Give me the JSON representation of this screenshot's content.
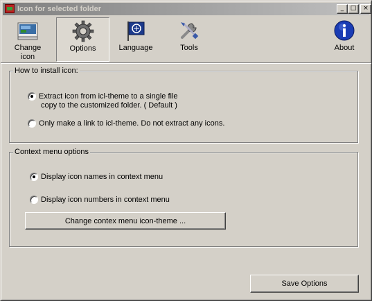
{
  "window": {
    "title": "Icon for selected folder",
    "minimize_glyph": "_",
    "maximize_glyph": "□",
    "close_glyph": "×"
  },
  "toolbar": {
    "items": [
      {
        "label": "Change\nicon",
        "icon": "change-icon-icon"
      },
      {
        "label": "Options",
        "icon": "gear-icon",
        "selected": true
      },
      {
        "label": "Language",
        "icon": "language-flag-icon"
      },
      {
        "label": "Tools",
        "icon": "tools-icon"
      },
      {
        "label": "About",
        "icon": "info-icon"
      }
    ]
  },
  "install_group": {
    "title": "How to install icon:",
    "option1_line1": "Extract icon from icl-theme to a single file",
    "option1_line2": "copy to the customized folder. ( Default )",
    "option2": "Only make a link to icl-theme. Do not extract any icons.",
    "selected": 1
  },
  "context_group": {
    "title": "Context menu options",
    "option1": "Display icon names in context menu",
    "option2": "Display icon numbers in context menu",
    "selected": 1,
    "change_button": "Change contex menu icon-theme ..."
  },
  "footer": {
    "save_button": "Save Options"
  },
  "colors": {
    "face": "#d4d0c8",
    "title_gradient_start": "#808080",
    "title_gradient_end": "#c0c0c0",
    "info_blue": "#1a3cb4"
  }
}
